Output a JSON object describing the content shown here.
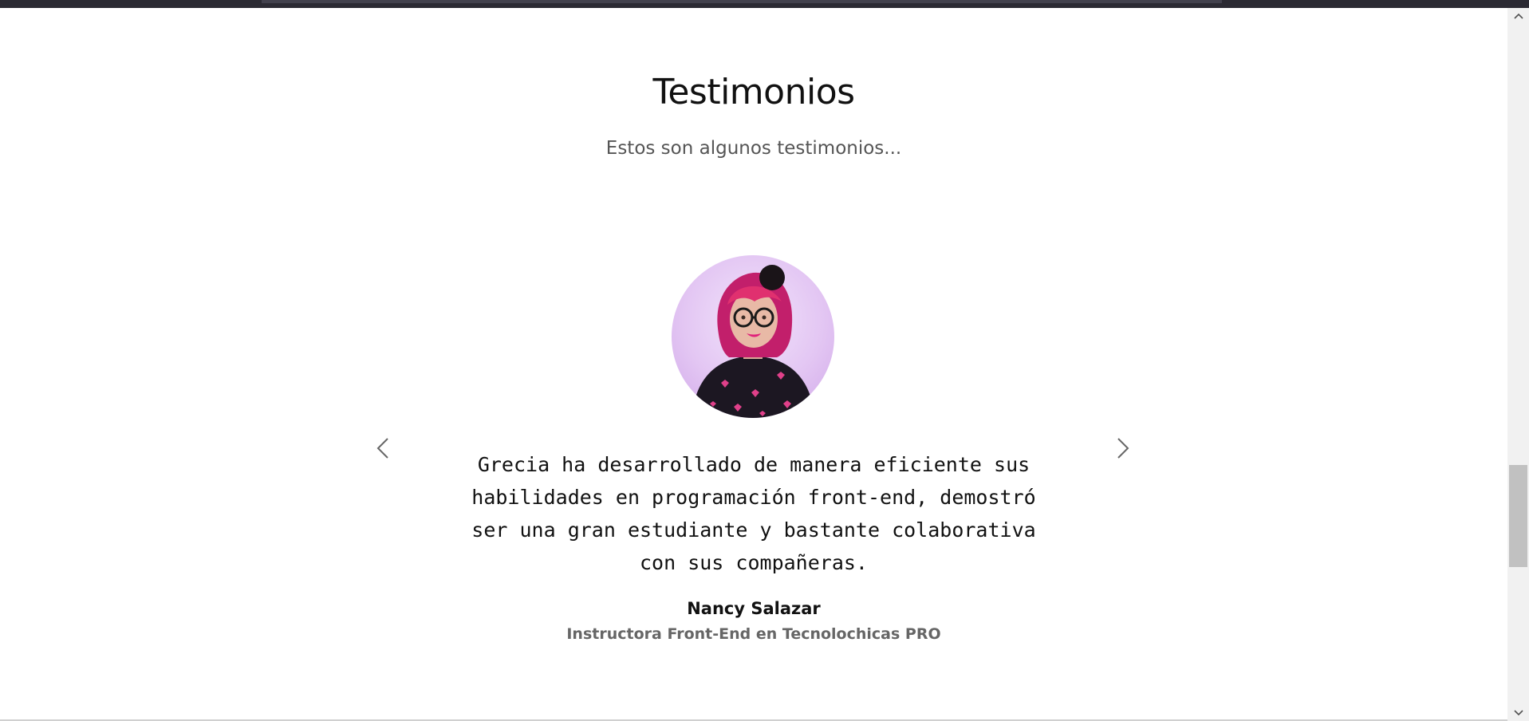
{
  "section": {
    "title": "Testimonios",
    "subtitle": "Estos son algunos testimonios..."
  },
  "testimonial": {
    "quote": "Grecia ha desarrollado de manera eficiente sus habilidades en programación front-end, demostró ser una gran estudiante y bastante colaborativa con sus compañeras.",
    "author_name": "Nancy Salazar",
    "author_role": "Instructora Front-End en Tecnolochicas PRO",
    "avatar_icon": "person-photo"
  },
  "carousel": {
    "prev_icon": "chevron-left-icon",
    "next_icon": "chevron-right-icon"
  },
  "colors": {
    "title": "#111111",
    "subtitle": "#555555",
    "role": "#666666",
    "avatar_background": "#e3c6f3"
  }
}
